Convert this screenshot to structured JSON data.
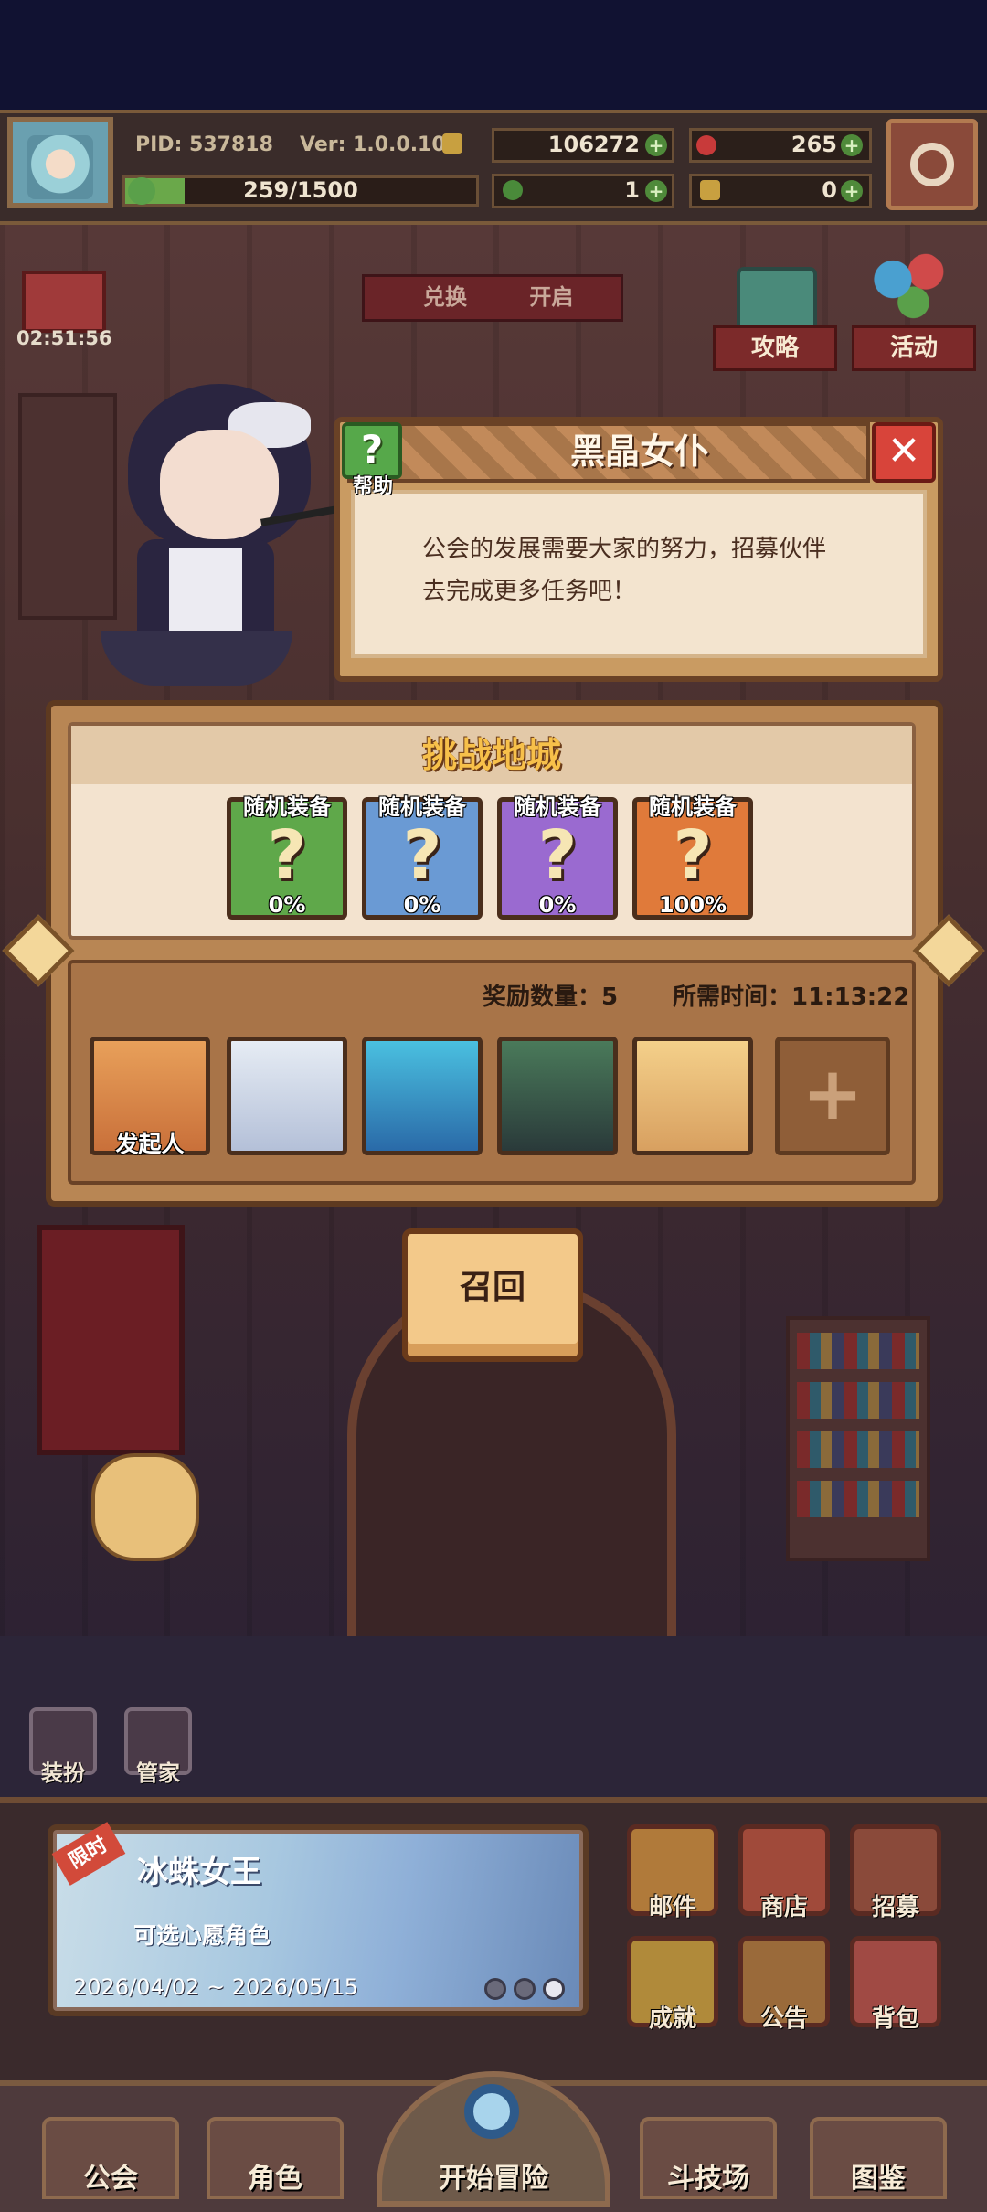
{
  "hud": {
    "pid": "PID: 537818",
    "version": "Ver: 1.0.0.10",
    "exp_text": "259/1500",
    "exp_progress": 0.17,
    "gold": "106272",
    "gems": "265",
    "clover": "1",
    "keys": "0"
  },
  "side": {
    "timer": "02:51:56",
    "guide_label": "攻略",
    "activity_label": "活动",
    "signboard": "兑换",
    "signboard_right": "开启"
  },
  "dialog": {
    "title": "黑晶女仆",
    "help_label": "帮助",
    "text_line1": "公会的发展需要大家的努力，招募伙伴",
    "text_line2": "去完成更多任务吧！"
  },
  "dungeon": {
    "title": "挑战地城",
    "rewards": [
      {
        "label": "随机装备",
        "percent": "0%",
        "color": "#5fa84a"
      },
      {
        "label": "随机装备",
        "percent": "0%",
        "color": "#6a9ad4"
      },
      {
        "label": "随机装备",
        "percent": "0%",
        "color": "#9a6ad0"
      },
      {
        "label": "随机装备",
        "percent": "100%",
        "color": "#e07a3a"
      }
    ],
    "reward_count": "奖励数量：5",
    "time_needed": "所需时间：11:13:22",
    "initiator_label": "发起人"
  },
  "recall_label": "召回",
  "mini_buttons": {
    "dress": "装扮",
    "butler": "管家"
  },
  "event": {
    "badge": "限时",
    "title": "冰蛛女王",
    "subtitle": "可选心愿角色",
    "date": "2026/04/02 ~ 2026/05/15"
  },
  "grid": [
    "邮件",
    "商店",
    "招募",
    "成就",
    "公告",
    "背包"
  ],
  "nav": {
    "guild": "公会",
    "character": "角色",
    "adventure": "开始冒险",
    "arena": "斗技场",
    "codex": "图鉴"
  }
}
